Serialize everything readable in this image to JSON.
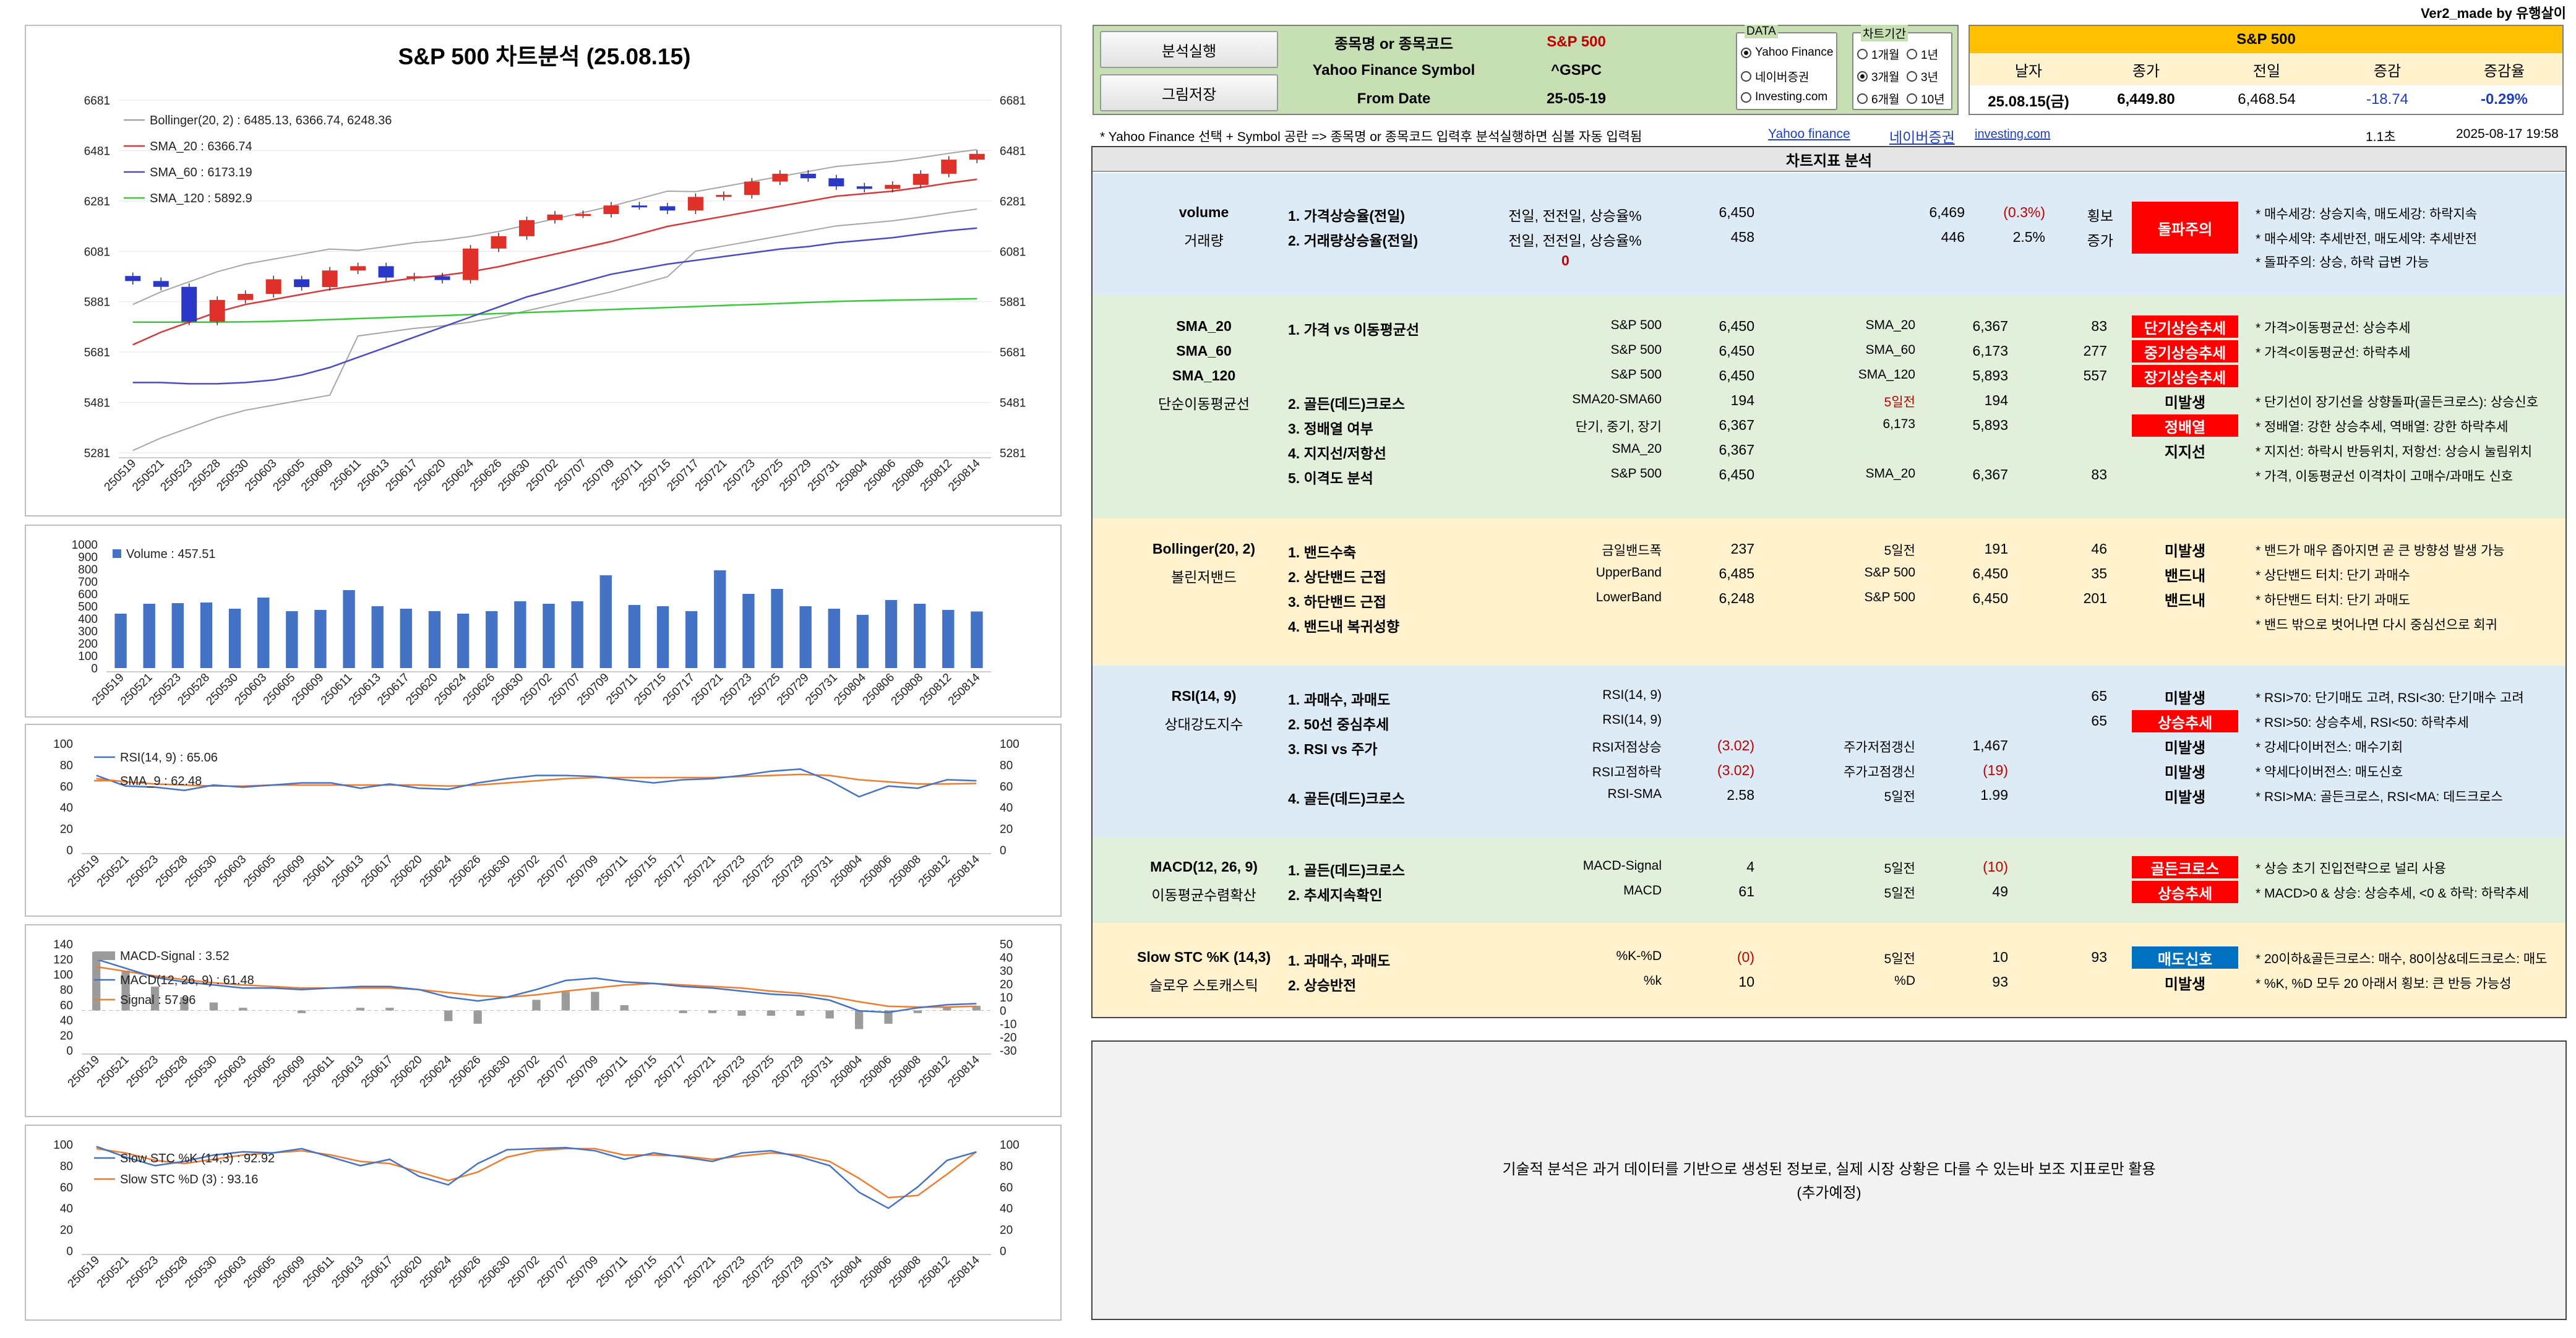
{
  "version_credit": "Ver2_made by 유행살이",
  "charts": {
    "price": {
      "title": "S&P 500 차트분석 (25.08.15)",
      "legend": [
        "Bollinger(20, 2) : 6485.13, 6366.74, 6248.36",
        "SMA_20 : 6366.74",
        "SMA_60 : 6173.19",
        "SMA_120 : 5892.9"
      ],
      "yticks": [
        "6681",
        "6481",
        "6281",
        "6081",
        "5881",
        "5681",
        "5481",
        "5281"
      ]
    },
    "volume": {
      "legend": "Volume : 457.51",
      "yticks": [
        "1000",
        "900",
        "800",
        "700",
        "600",
        "500",
        "400",
        "300",
        "200",
        "100",
        "0"
      ]
    },
    "rsi": {
      "legend": [
        "RSI(14, 9) : 65.06",
        "SMA_9 : 62.48"
      ],
      "yticks": [
        "100",
        "80",
        "60",
        "40",
        "20",
        "0"
      ]
    },
    "macd": {
      "legend": [
        "MACD-Signal : 3.52",
        "MACD(12, 26, 9) : 61.48",
        "Signal : 57.96"
      ],
      "yticks_left": [
        "140",
        "120",
        "100",
        "80",
        "60",
        "40",
        "20",
        "0"
      ],
      "yticks_right": [
        "50",
        "40",
        "30",
        "20",
        "10",
        "0",
        "-10",
        "-20",
        "-30"
      ]
    },
    "stoch": {
      "legend": [
        "Slow STC %K (14,3) : 92.92",
        "Slow STC %D (3) : 93.16"
      ],
      "yticks": [
        "100",
        "80",
        "60",
        "40",
        "20",
        "0"
      ]
    },
    "xdates": [
      "250519",
      "250521",
      "250523",
      "250528",
      "250530",
      "250603",
      "250605",
      "250609",
      "250611",
      "250613",
      "250617",
      "250620",
      "250624",
      "250626",
      "250630",
      "250702",
      "250707",
      "250709",
      "250711",
      "250715",
      "250717",
      "250721",
      "250723",
      "250725",
      "250729",
      "250731",
      "250804",
      "250806",
      "250808",
      "250812",
      "250814"
    ]
  },
  "chart_data": [
    {
      "type": "line",
      "title": "S&P 500 차트분석 (25.08.15)",
      "ylim": [
        5281,
        6681
      ],
      "note": "candlestick price with Bollinger and SMAs",
      "x": [
        "250519",
        "250521",
        "250523",
        "250528",
        "250530",
        "250603",
        "250605",
        "250609",
        "250611",
        "250613",
        "250617",
        "250620",
        "250624",
        "250626",
        "250630",
        "250702",
        "250707",
        "250709",
        "250711",
        "250715",
        "250717",
        "250721",
        "250723",
        "250725",
        "250729",
        "250731",
        "250804",
        "250806",
        "250808",
        "250812",
        "250814"
      ],
      "series": [
        {
          "name": "Close",
          "values": [
            5963,
            5940,
            5802,
            5888,
            5912,
            5970,
            5939,
            6005,
            6022,
            5977,
            5982,
            5967,
            6092,
            6141,
            6205,
            6227,
            6229,
            6263,
            6260,
            6243,
            6297,
            6305,
            6358,
            6389,
            6371,
            6339,
            6329,
            6345,
            6389,
            6445,
            6468
          ]
        },
        {
          "name": "SMA_20",
          "values": [
            5710,
            5760,
            5800,
            5840,
            5870,
            5890,
            5910,
            5930,
            5945,
            5960,
            5975,
            5985,
            6000,
            6020,
            6045,
            6070,
            6095,
            6120,
            6150,
            6180,
            6200,
            6220,
            6240,
            6260,
            6280,
            6300,
            6310,
            6320,
            6335,
            6352,
            6366.74
          ]
        },
        {
          "name": "SMA_60",
          "values": [
            5560,
            5560,
            5555,
            5555,
            5560,
            5570,
            5590,
            5620,
            5660,
            5700,
            5740,
            5780,
            5820,
            5860,
            5900,
            5930,
            5960,
            5990,
            6010,
            6030,
            6045,
            6060,
            6075,
            6090,
            6100,
            6115,
            6125,
            6135,
            6150,
            6163,
            6173.19
          ]
        },
        {
          "name": "SMA_120",
          "values": [
            5800,
            5800,
            5800,
            5800,
            5801,
            5803,
            5806,
            5810,
            5814,
            5818,
            5822,
            5826,
            5830,
            5834,
            5838,
            5842,
            5846,
            5850,
            5854,
            5858,
            5862,
            5866,
            5870,
            5874,
            5878,
            5882,
            5885,
            5887,
            5889,
            5891,
            5892.9
          ]
        }
      ]
    },
    {
      "type": "bar",
      "legend": "Volume : 457.51",
      "ylim": [
        0,
        1000
      ],
      "values": [
        440,
        520,
        525,
        530,
        480,
        570,
        460,
        470,
        630,
        500,
        480,
        460,
        440,
        460,
        540,
        520,
        540,
        750,
        510,
        500,
        460,
        790,
        600,
        640,
        500,
        480,
        430,
        550,
        520,
        470,
        457.51
      ]
    },
    {
      "type": "line",
      "ylim": [
        0,
        100
      ],
      "series": [
        {
          "name": "RSI(14, 9)",
          "values": [
            70,
            60,
            59,
            56,
            61,
            59,
            61,
            63,
            63,
            58,
            62,
            58,
            57,
            63,
            67,
            70,
            70,
            69,
            66,
            63,
            66,
            67,
            70,
            74,
            76,
            65,
            50,
            60,
            58,
            66,
            65.06
          ]
        },
        {
          "name": "SMA_9",
          "values": [
            67,
            64,
            62,
            61,
            60,
            60,
            61,
            61,
            61,
            61,
            61,
            61,
            60,
            61,
            63,
            65,
            67,
            68,
            68,
            68,
            68,
            68,
            69,
            70,
            71,
            70,
            66,
            64,
            62,
            62,
            62.48
          ]
        }
      ]
    },
    {
      "type": "line",
      "ylim": [
        0,
        140
      ],
      "series": [
        {
          "name": "MACD(12, 26, 9)",
          "values": [
            120,
            108,
            96,
            90,
            86,
            82,
            82,
            80,
            82,
            84,
            84,
            80,
            70,
            65,
            70,
            80,
            92,
            95,
            90,
            88,
            84,
            82,
            78,
            74,
            72,
            66,
            52,
            50,
            56,
            60,
            61.48
          ]
        },
        {
          "name": "Signal",
          "values": [
            110,
            104,
            98,
            93,
            89,
            86,
            84,
            82,
            82,
            82,
            82,
            80,
            76,
            72,
            70,
            73,
            78,
            82,
            86,
            88,
            86,
            84,
            82,
            78,
            75,
            71,
            64,
            58,
            57,
            57,
            57.96
          ]
        },
        {
          "name": "MACD-Signal",
          "values": [
            44,
            30,
            18,
            10,
            6,
            2,
            0,
            -2,
            0,
            2,
            2,
            0,
            -8,
            -10,
            0,
            8,
            14,
            14,
            4,
            0,
            -2,
            -2,
            -4,
            -4,
            -4,
            -6,
            -14,
            -10,
            -2,
            3,
            3.52
          ]
        }
      ]
    },
    {
      "type": "line",
      "ylim": [
        0,
        100
      ],
      "series": [
        {
          "name": "Slow STC %K (14,3)",
          "values": [
            98,
            88,
            80,
            84,
            90,
            93,
            92,
            96,
            88,
            80,
            86,
            70,
            62,
            82,
            95,
            96,
            97,
            94,
            86,
            92,
            88,
            84,
            92,
            94,
            88,
            80,
            55,
            40,
            60,
            85,
            92.92
          ]
        },
        {
          "name": "Slow STC %D (3)",
          "values": [
            96,
            92,
            85,
            82,
            86,
            90,
            92,
            94,
            90,
            84,
            82,
            74,
            66,
            74,
            88,
            94,
            96,
            96,
            90,
            90,
            89,
            86,
            89,
            92,
            90,
            84,
            68,
            50,
            52,
            72,
            93.16
          ]
        }
      ]
    }
  ],
  "toolbar": {
    "run_button": "분석실행",
    "save_button": "그림저장",
    "rows": [
      {
        "label": "종목명 or 종목코드",
        "value": "S&P 500"
      },
      {
        "label": "Yahoo Finance Symbol",
        "value": "^GSPC"
      },
      {
        "label": "From Date",
        "value": "25-05-19"
      }
    ],
    "data_group": {
      "title": "DATA",
      "options": [
        "Yahoo Finance",
        "네이버증권",
        "Investing.com"
      ],
      "selected": 0
    },
    "period_group": {
      "title": "차트기간",
      "options": [
        "1개월",
        "1년",
        "3개월",
        "3년",
        "6개월",
        "10년"
      ],
      "selected": 2
    }
  },
  "quote": {
    "name": "S&P 500",
    "headers": [
      "날자",
      "종가",
      "전일",
      "증감",
      "증감율"
    ],
    "values": [
      "25.08.15(금)",
      "6,449.80",
      "6,468.54",
      "-18.74",
      "-0.29%"
    ]
  },
  "info_bar": {
    "note": "* Yahoo Finance 선택 + Symbol 공란 =>  종목명 or 종목코드 입력후 분석실행하면 심볼 자동 입력됨",
    "links": [
      "Yahoo finance",
      "네이버증권",
      "investing.com"
    ],
    "elapsed": "1.1초",
    "datetime": "2025-08-17 19:58"
  },
  "analysis_title": "차트지표 분석",
  "volume_sec": {
    "name": "volume",
    "sub": "거래량",
    "rows": [
      {
        "item": "1. 가격상승율(전일)",
        "desc": "전일, 전전일, 상승율%",
        "v1": "6,450",
        "v2": "6,469",
        "v3": "(0.3%)",
        "trend": "횡보"
      },
      {
        "item": "2. 거래량상승율(전일)",
        "desc": "전일, 전전일, 상승율%",
        "v1": "458",
        "v2": "446",
        "v3": "2.5%",
        "trend": "증가"
      }
    ],
    "zero": "0",
    "badge": "돌파주의",
    "notes": [
      "* 매수세강: 상승지속, 매도세강: 하락지속",
      "* 매수세약: 추세반전, 매도세약: 추세반전",
      "* 돌파주의: 상승, 하락 급변 가능"
    ]
  },
  "sma_sec": {
    "names": [
      "SMA_20",
      "SMA_60",
      "SMA_120"
    ],
    "sub": "단순이동평균선",
    "rows": [
      {
        "item": "1. 가격 vs 이동평균선",
        "d1": "S&P 500",
        "v1": "6,450",
        "d2": "SMA_20",
        "v2": "6,367",
        "n": "83",
        "st": "단기상승추세"
      },
      {
        "item": "",
        "d1": "S&P 500",
        "v1": "6,450",
        "d2": "SMA_60",
        "v2": "6,173",
        "n": "277",
        "st": "중기상승추세"
      },
      {
        "item": "",
        "d1": "S&P 500",
        "v1": "6,450",
        "d2": "SMA_120",
        "v2": "5,893",
        "n": "557",
        "st": "장기상승추세"
      },
      {
        "item": "2. 골든(데드)크로스",
        "d1": "SMA20-SMA60",
        "v1": "194",
        "d2": "5일전",
        "v2": "194",
        "n": "",
        "st": "미발생"
      },
      {
        "item": "3. 정배열 여부",
        "d1": "단기, 중기, 장기",
        "v1": "6,367",
        "d2": "6,173",
        "v2": "5,893",
        "n": "",
        "st": "정배열"
      },
      {
        "item": "4. 지지선/저항선",
        "d1": "SMA_20",
        "v1": "6,367",
        "d2": "",
        "v2": "",
        "n": "",
        "st": "지지선"
      },
      {
        "item": "5. 이격도 분석",
        "d1": "S&P 500",
        "v1": "6,450",
        "d2": "SMA_20",
        "v2": "6,367",
        "n": "83",
        "st": ""
      }
    ],
    "notes": [
      "* 가격>이동평균선: 상승추세",
      "* 가격<이동평균선: 하락추세",
      "",
      "* 단기선이 장기선을 상향돌파(골든크로스): 상승신호",
      "* 정배열: 강한 상승추세, 역배열: 강한 하락추세",
      "* 지지선: 하락시 반등위치, 저항선: 상승시 눌림위치",
      "* 가격, 이동평균선 이격차이 고매수/과매도 신호"
    ]
  },
  "boll_sec": {
    "name": "Bollinger(20, 2)",
    "sub": "볼린저밴드",
    "rows": [
      {
        "item": "1. 밴드수축",
        "d1": "금일밴드폭",
        "v1": "237",
        "d2": "5일전",
        "v2": "191",
        "n": "46",
        "st": "미발생"
      },
      {
        "item": "2. 상단밴드 근접",
        "d1": "UpperBand",
        "v1": "6,485",
        "d2": "S&P 500",
        "v2": "6,450",
        "n": "35",
        "st": "밴드내"
      },
      {
        "item": "3. 하단밴드 근접",
        "d1": "LowerBand",
        "v1": "6,248",
        "d2": "S&P 500",
        "v2": "6,450",
        "n": "201",
        "st": "밴드내"
      },
      {
        "item": "4. 밴드내 복귀성향",
        "d1": "",
        "v1": "",
        "d2": "",
        "v2": "",
        "n": "",
        "st": ""
      }
    ],
    "notes": [
      "* 밴드가 매우 좁아지면 곧 큰 방향성 발생 가능",
      "* 상단밴드 터치: 단기 과매수",
      "* 하단밴드 터치: 단기 과매도",
      "* 밴드 밖으로 벗어나면 다시 중심선으로 회귀"
    ]
  },
  "rsi_sec": {
    "name": "RSI(14, 9)",
    "sub": "상대강도지수",
    "rows": [
      {
        "item": "1. 과매수, 과매도",
        "d1": "RSI(14, 9)",
        "v1": "",
        "d2": "",
        "v2": "",
        "n": "65",
        "st": "미발생"
      },
      {
        "item": "2. 50선 중심추세",
        "d1": "RSI(14, 9)",
        "v1": "",
        "d2": "",
        "v2": "",
        "n": "65",
        "st": "상승추세"
      },
      {
        "item": "3. RSI vs 주가",
        "d1": "RSI저점상승",
        "v1": "(3.02)",
        "d2": "주가저점갱신",
        "v2": "1,467",
        "n": "",
        "st": "미발생"
      },
      {
        "item": "",
        "d1": "RSI고점하락",
        "v1": "(3.02)",
        "d2": "주가고점갱신",
        "v2": "(19)",
        "n": "",
        "st": "미발생"
      },
      {
        "item": "4. 골든(데드)크로스",
        "d1": "RSI-SMA",
        "v1": "2.58",
        "d2": "5일전",
        "v2": "1.99",
        "n": "",
        "st": "미발생"
      }
    ],
    "notes": [
      "* RSI>70: 단기매도 고려, RSI<30: 단기매수 고려",
      "* RSI>50: 상승추세, RSI<50: 하락추세",
      "* 강세다이버전스: 매수기회",
      "* 약세다이버전스: 매도신호",
      "* RSI>MA: 골든크로스, RSI<MA: 데드크로스"
    ]
  },
  "macd_sec": {
    "name": "MACD(12, 26, 9)",
    "sub": "이동평균수렴확산",
    "rows": [
      {
        "item": "1. 골든(데드)크로스",
        "d1": "MACD-Signal",
        "v1": "4",
        "d2": "5일전",
        "v2": "(10)",
        "st": "골든크로스"
      },
      {
        "item": "2. 추세지속확인",
        "d1": "MACD",
        "v1": "61",
        "d2": "5일전",
        "v2": "49",
        "st": "상승추세"
      }
    ],
    "notes": [
      "* 상승 초기 진입전략으로 널리 사용",
      "* MACD>0 & 상승: 상승추세, <0 & 하락: 하락추세"
    ]
  },
  "stc_sec": {
    "name": "Slow STC %K (14,3)",
    "sub": "슬로우 스토캐스틱",
    "rows": [
      {
        "item": "1. 과매수, 과매도",
        "d1": "%K-%D",
        "v1": "(0)",
        "d2": "5일전",
        "v2": "10",
        "n": "93",
        "st": "매도신호"
      },
      {
        "item": "2. 상승반전",
        "d1": "%k",
        "v1": "10",
        "d2": "%D",
        "v2": "93",
        "n": "",
        "st": "미발생"
      }
    ],
    "notes": [
      "* 20이하&골든크로스: 매수, 80이상&데드크로스: 매도",
      "* %K, %D 모두 20 아래서 횡보: 큰 반등 가능성"
    ]
  },
  "disclaimer": {
    "line1": "기술적 분석은 과거 데이터를 기반으로 생성된 정보로, 실제 시장 상황은 다를 수 있는바 보조 지표로만 활용",
    "line2": "(추가예정)"
  },
  "colors": {
    "green_bg": "#c6e0b4",
    "yellow_bg": "#ffc000",
    "blue_sec": "#ddebf7",
    "green_sec": "#e2efda",
    "yellow_sec": "#fff2cc",
    "red_badge": "#ff0000",
    "blue_badge": "#0070c0"
  }
}
